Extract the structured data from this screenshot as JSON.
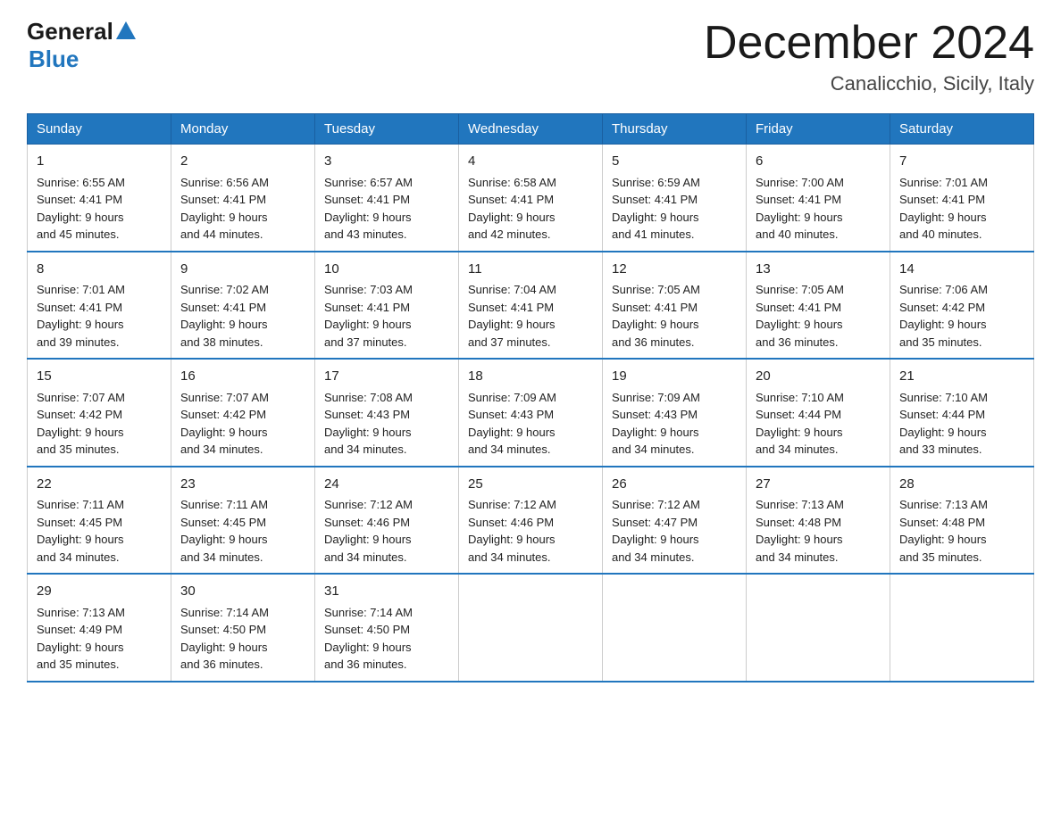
{
  "header": {
    "logo_general": "General",
    "logo_blue": "Blue",
    "title": "December 2024",
    "subtitle": "Canalicchio, Sicily, Italy"
  },
  "days_of_week": [
    "Sunday",
    "Monday",
    "Tuesday",
    "Wednesday",
    "Thursday",
    "Friday",
    "Saturday"
  ],
  "weeks": [
    [
      {
        "day": "1",
        "sunrise": "6:55 AM",
        "sunset": "4:41 PM",
        "daylight": "9 hours and 45 minutes."
      },
      {
        "day": "2",
        "sunrise": "6:56 AM",
        "sunset": "4:41 PM",
        "daylight": "9 hours and 44 minutes."
      },
      {
        "day": "3",
        "sunrise": "6:57 AM",
        "sunset": "4:41 PM",
        "daylight": "9 hours and 43 minutes."
      },
      {
        "day": "4",
        "sunrise": "6:58 AM",
        "sunset": "4:41 PM",
        "daylight": "9 hours and 42 minutes."
      },
      {
        "day": "5",
        "sunrise": "6:59 AM",
        "sunset": "4:41 PM",
        "daylight": "9 hours and 41 minutes."
      },
      {
        "day": "6",
        "sunrise": "7:00 AM",
        "sunset": "4:41 PM",
        "daylight": "9 hours and 40 minutes."
      },
      {
        "day": "7",
        "sunrise": "7:01 AM",
        "sunset": "4:41 PM",
        "daylight": "9 hours and 40 minutes."
      }
    ],
    [
      {
        "day": "8",
        "sunrise": "7:01 AM",
        "sunset": "4:41 PM",
        "daylight": "9 hours and 39 minutes."
      },
      {
        "day": "9",
        "sunrise": "7:02 AM",
        "sunset": "4:41 PM",
        "daylight": "9 hours and 38 minutes."
      },
      {
        "day": "10",
        "sunrise": "7:03 AM",
        "sunset": "4:41 PM",
        "daylight": "9 hours and 37 minutes."
      },
      {
        "day": "11",
        "sunrise": "7:04 AM",
        "sunset": "4:41 PM",
        "daylight": "9 hours and 37 minutes."
      },
      {
        "day": "12",
        "sunrise": "7:05 AM",
        "sunset": "4:41 PM",
        "daylight": "9 hours and 36 minutes."
      },
      {
        "day": "13",
        "sunrise": "7:05 AM",
        "sunset": "4:41 PM",
        "daylight": "9 hours and 36 minutes."
      },
      {
        "day": "14",
        "sunrise": "7:06 AM",
        "sunset": "4:42 PM",
        "daylight": "9 hours and 35 minutes."
      }
    ],
    [
      {
        "day": "15",
        "sunrise": "7:07 AM",
        "sunset": "4:42 PM",
        "daylight": "9 hours and 35 minutes."
      },
      {
        "day": "16",
        "sunrise": "7:07 AM",
        "sunset": "4:42 PM",
        "daylight": "9 hours and 34 minutes."
      },
      {
        "day": "17",
        "sunrise": "7:08 AM",
        "sunset": "4:43 PM",
        "daylight": "9 hours and 34 minutes."
      },
      {
        "day": "18",
        "sunrise": "7:09 AM",
        "sunset": "4:43 PM",
        "daylight": "9 hours and 34 minutes."
      },
      {
        "day": "19",
        "sunrise": "7:09 AM",
        "sunset": "4:43 PM",
        "daylight": "9 hours and 34 minutes."
      },
      {
        "day": "20",
        "sunrise": "7:10 AM",
        "sunset": "4:44 PM",
        "daylight": "9 hours and 34 minutes."
      },
      {
        "day": "21",
        "sunrise": "7:10 AM",
        "sunset": "4:44 PM",
        "daylight": "9 hours and 33 minutes."
      }
    ],
    [
      {
        "day": "22",
        "sunrise": "7:11 AM",
        "sunset": "4:45 PM",
        "daylight": "9 hours and 34 minutes."
      },
      {
        "day": "23",
        "sunrise": "7:11 AM",
        "sunset": "4:45 PM",
        "daylight": "9 hours and 34 minutes."
      },
      {
        "day": "24",
        "sunrise": "7:12 AM",
        "sunset": "4:46 PM",
        "daylight": "9 hours and 34 minutes."
      },
      {
        "day": "25",
        "sunrise": "7:12 AM",
        "sunset": "4:46 PM",
        "daylight": "9 hours and 34 minutes."
      },
      {
        "day": "26",
        "sunrise": "7:12 AM",
        "sunset": "4:47 PM",
        "daylight": "9 hours and 34 minutes."
      },
      {
        "day": "27",
        "sunrise": "7:13 AM",
        "sunset": "4:48 PM",
        "daylight": "9 hours and 34 minutes."
      },
      {
        "day": "28",
        "sunrise": "7:13 AM",
        "sunset": "4:48 PM",
        "daylight": "9 hours and 35 minutes."
      }
    ],
    [
      {
        "day": "29",
        "sunrise": "7:13 AM",
        "sunset": "4:49 PM",
        "daylight": "9 hours and 35 minutes."
      },
      {
        "day": "30",
        "sunrise": "7:14 AM",
        "sunset": "4:50 PM",
        "daylight": "9 hours and 36 minutes."
      },
      {
        "day": "31",
        "sunrise": "7:14 AM",
        "sunset": "4:50 PM",
        "daylight": "9 hours and 36 minutes."
      },
      null,
      null,
      null,
      null
    ]
  ],
  "labels": {
    "sunrise": "Sunrise:",
    "sunset": "Sunset:",
    "daylight": "Daylight:"
  }
}
